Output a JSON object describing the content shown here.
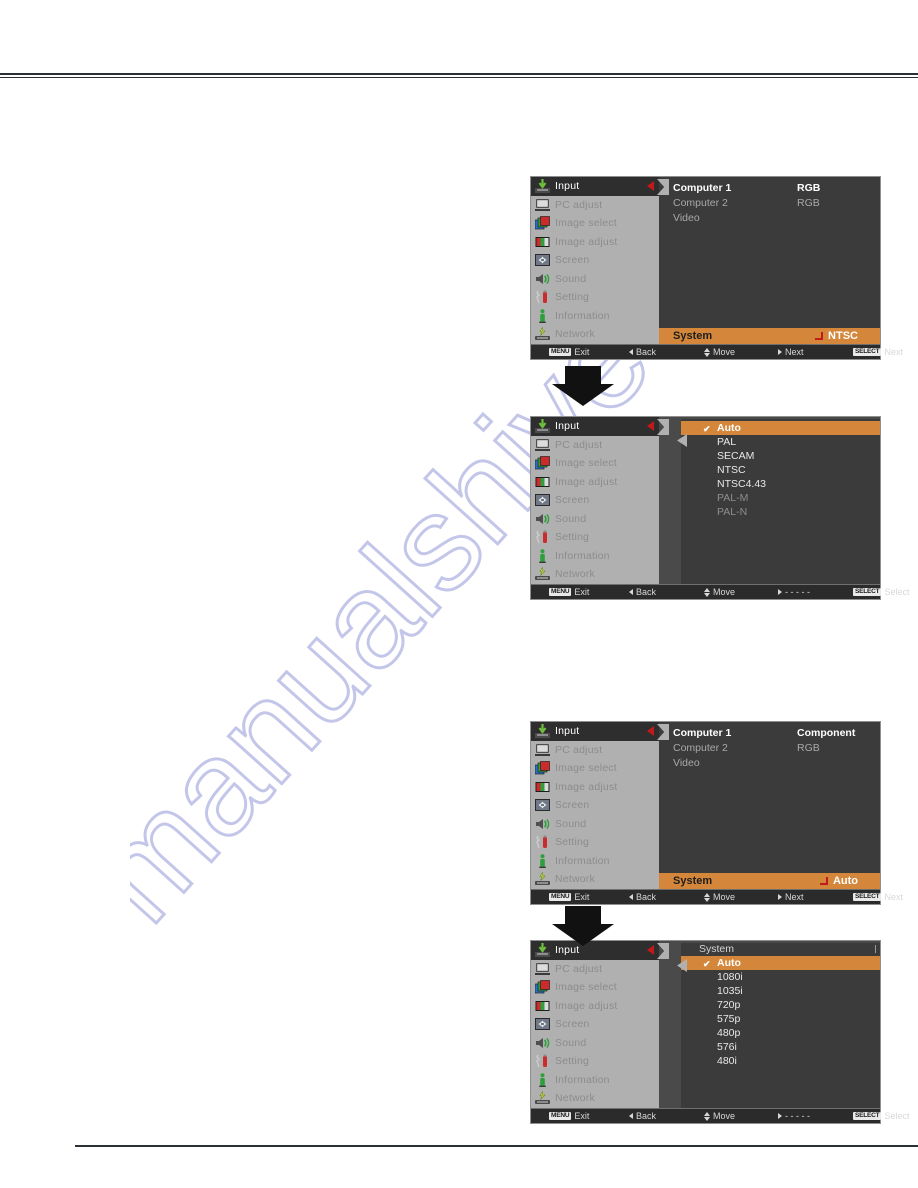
{
  "watermark": {
    "text": "manualshive.com"
  },
  "menu": {
    "items": [
      {
        "label": "Input",
        "icon": "input-icon"
      },
      {
        "label": "PC adjust",
        "icon": "monitor-icon"
      },
      {
        "label": "Image select",
        "icon": "image-select-icon"
      },
      {
        "label": "Image adjust",
        "icon": "image-adjust-icon"
      },
      {
        "label": "Screen",
        "icon": "screen-icon"
      },
      {
        "label": "Sound",
        "icon": "speaker-icon"
      },
      {
        "label": "Setting",
        "icon": "wrench-icon"
      },
      {
        "label": "Information",
        "icon": "info-icon"
      },
      {
        "label": "Network",
        "icon": "network-icon"
      }
    ],
    "active_index": 0
  },
  "colors": {
    "highlight": "#d4873a",
    "sidebar_bg": "#b0b0b0",
    "content_bg": "#3b3b3b",
    "active_row": "#2e2e2e",
    "marker_red": "#c01a1a"
  },
  "panel1": {
    "sources": [
      {
        "name": "Computer 1",
        "value": "RGB",
        "selected": true
      },
      {
        "name": "Computer 2",
        "value": "RGB",
        "selected": false
      },
      {
        "name": "Video",
        "value": "",
        "selected": false
      }
    ],
    "system_label": "System",
    "system_value": "NTSC",
    "statusbar": [
      {
        "key": "MENU",
        "label": "Exit"
      },
      {
        "key": "left",
        "label": "Back"
      },
      {
        "key": "updown",
        "label": "Move"
      },
      {
        "key": "right",
        "label": "Next"
      },
      {
        "key": "SELECT",
        "label": "Next"
      }
    ]
  },
  "panel2": {
    "header": "",
    "options": [
      {
        "label": "Auto",
        "state": "highlighted"
      },
      {
        "label": "PAL",
        "state": "normal"
      },
      {
        "label": "SECAM",
        "state": "normal"
      },
      {
        "label": "NTSC",
        "state": "normal"
      },
      {
        "label": "NTSC4.43",
        "state": "normal"
      },
      {
        "label": "PAL-M",
        "state": "dimmed"
      },
      {
        "label": "PAL-N",
        "state": "dimmed"
      }
    ],
    "statusbar": [
      {
        "key": "MENU",
        "label": "Exit"
      },
      {
        "key": "left",
        "label": "Back"
      },
      {
        "key": "updown",
        "label": "Move"
      },
      {
        "key": "right",
        "label": "- - - - -"
      },
      {
        "key": "SELECT",
        "label": "Select"
      }
    ]
  },
  "panel3": {
    "sources": [
      {
        "name": "Computer 1",
        "value": "Component",
        "selected": true
      },
      {
        "name": "Computer 2",
        "value": "RGB",
        "selected": false
      },
      {
        "name": "Video",
        "value": "",
        "selected": false
      }
    ],
    "system_label": "System",
    "system_value": "Auto",
    "statusbar": [
      {
        "key": "MENU",
        "label": "Exit"
      },
      {
        "key": "left",
        "label": "Back"
      },
      {
        "key": "updown",
        "label": "Move"
      },
      {
        "key": "right",
        "label": "Next"
      },
      {
        "key": "SELECT",
        "label": "Next"
      }
    ]
  },
  "panel4": {
    "header": "System",
    "options": [
      {
        "label": "Auto",
        "state": "highlighted"
      },
      {
        "label": "1080i",
        "state": "normal"
      },
      {
        "label": "1035i",
        "state": "normal"
      },
      {
        "label": "720p",
        "state": "normal"
      },
      {
        "label": "575p",
        "state": "normal"
      },
      {
        "label": "480p",
        "state": "normal"
      },
      {
        "label": "576i",
        "state": "normal"
      },
      {
        "label": "480i",
        "state": "normal"
      }
    ],
    "statusbar": [
      {
        "key": "MENU",
        "label": "Exit"
      },
      {
        "key": "left",
        "label": "Back"
      },
      {
        "key": "updown",
        "label": "Move"
      },
      {
        "key": "right",
        "label": "- - - - -"
      },
      {
        "key": "SELECT",
        "label": "Select"
      }
    ]
  }
}
